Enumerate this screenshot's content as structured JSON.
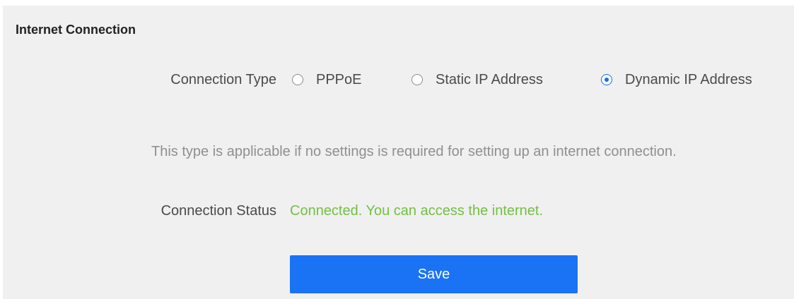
{
  "section": {
    "title": "Internet Connection"
  },
  "connection_type": {
    "label": "Connection Type",
    "options": [
      {
        "label": "PPPoE",
        "selected": false
      },
      {
        "label": "Static IP Address",
        "selected": false
      },
      {
        "label": "Dynamic IP Address",
        "selected": true
      }
    ],
    "hint": "This type is applicable if no settings is required for setting up an internet connection."
  },
  "connection_status": {
    "label": "Connection Status",
    "value": "Connected. You can access the internet."
  },
  "actions": {
    "save_label": "Save"
  },
  "colors": {
    "panel_background": "#f0f0f0",
    "accent_blue": "#1a73f5",
    "status_green": "#72c142",
    "hint_gray": "#8f8f8f",
    "label_text": "#4a4a4a"
  }
}
